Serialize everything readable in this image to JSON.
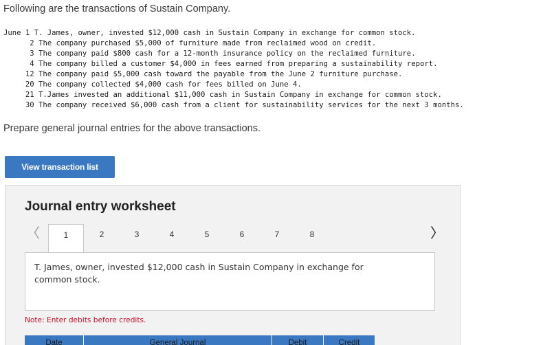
{
  "intro": "Following are the transactions of Sustain Company.",
  "transactions": [
    {
      "date": "June 1",
      "text": "T. James, owner, invested $12,000 cash in Sustain Company in exchange for common stock."
    },
    {
      "date": "2",
      "text": "The company purchased $5,000 of furniture made from reclaimed wood on credit."
    },
    {
      "date": "3",
      "text": "The company paid $800 cash for a 12-month insurance policy on the reclaimed furniture."
    },
    {
      "date": "4",
      "text": "The company billed a customer $4,000 in fees earned from preparing a sustainability report."
    },
    {
      "date": "12",
      "text": "The company paid $5,000 cash toward the payable from the June 2 furniture purchase."
    },
    {
      "date": "20",
      "text": "The company collected $4,000 cash for fees billed on June 4."
    },
    {
      "date": "21",
      "text": "T.James invested an additional $11,000 cash in Sustain Company in exchange for common stock."
    },
    {
      "date": "30",
      "text": "The company received $6,000 cash from a client for sustainability services for the next 3 months."
    }
  ],
  "prepare": "Prepare general journal entries for the above transactions.",
  "view_button": "View transaction list",
  "worksheet": {
    "title": "Journal entry worksheet",
    "prev_icon": "chevron-left-icon",
    "next_icon": "chevron-right-icon",
    "tabs": [
      "1",
      "2",
      "3",
      "4",
      "5",
      "6",
      "7",
      "8"
    ],
    "active_tab": "1",
    "description": "T. James, owner, invested $12,000 cash in Sustain Company in exchange for common stock.",
    "note": "Note: Enter debits before credits.",
    "columns": [
      "Date",
      "General Journal",
      "Debit",
      "Credit"
    ]
  },
  "colors": {
    "accent": "#3b78c2",
    "note": "#c8102e",
    "panel": "#f2f2f2"
  }
}
